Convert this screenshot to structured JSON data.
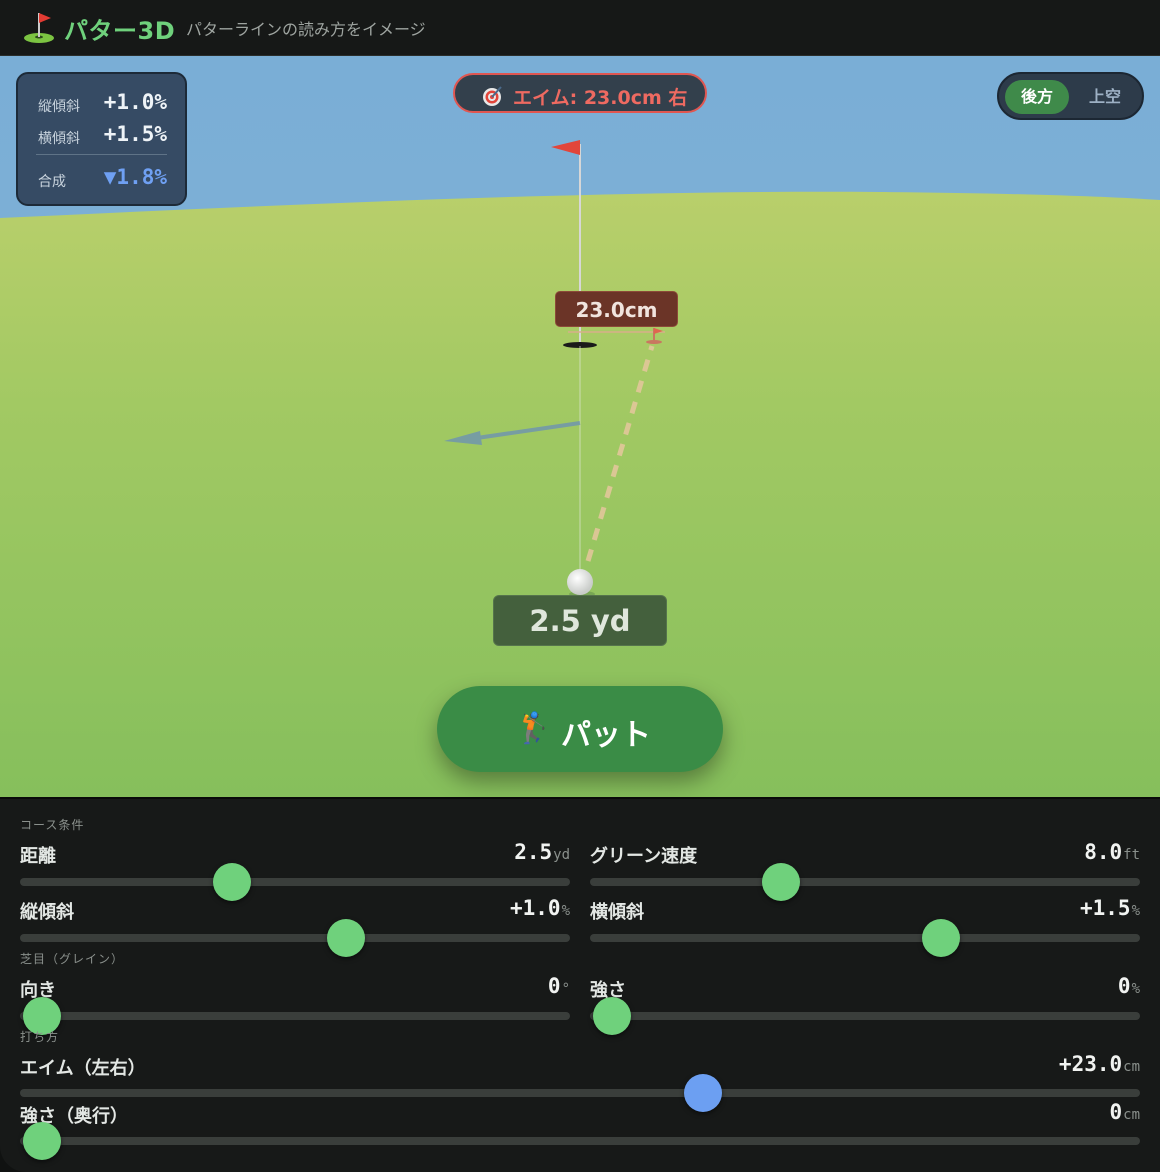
{
  "header": {
    "title": "パター3D",
    "subtitle": "パターラインの読み方をイメージ"
  },
  "scene": {
    "slope": {
      "vertical_label": "縦傾斜",
      "vertical_value": "+1.0%",
      "horizontal_label": "横傾斜",
      "horizontal_value": "+1.5%",
      "combined_label": "合成",
      "combined_value": "▼1.8%"
    },
    "aim_badge": "エイム: 23.0cm 右",
    "view_toggle": {
      "options": [
        "後方",
        "上空"
      ],
      "selected": "後方"
    },
    "aim_distance_label": "23.0cm",
    "ball_distance_label": "2.5 yd",
    "putt_button": {
      "label": "パット"
    }
  },
  "controls": {
    "sections": {
      "course": "コース条件",
      "grain": "芝目（グレイン）",
      "stroke": "打ち方"
    },
    "distance": {
      "label": "距離",
      "value": "2.5",
      "unit": "yd",
      "fraction": 0.385
    },
    "green_speed": {
      "label": "グリーン速度",
      "value": "8.0",
      "unit": "ft",
      "fraction": 0.347
    },
    "vertical": {
      "label": "縦傾斜",
      "value": "+1.0",
      "unit": "%",
      "fraction": 0.592
    },
    "horizontal": {
      "label": "横傾斜",
      "value": "+1.5",
      "unit": "%",
      "fraction": 0.638
    },
    "grain_dir": {
      "label": "向き",
      "value": "0",
      "unit": "°",
      "fraction": 0.0
    },
    "grain_str": {
      "label": "強さ",
      "value": "0",
      "unit": "%",
      "fraction": 0.0
    },
    "aim": {
      "label": "エイム（左右）",
      "value": "+23.0",
      "unit": "cm",
      "fraction": 0.61
    },
    "power": {
      "label": "強さ（奥行）",
      "value": "0",
      "unit": "cm",
      "fraction": 0.0
    }
  },
  "colors": {
    "accent_green": "#6fd17c",
    "aim_red": "#e05651",
    "aim_slider_blue": "#6c9ff2"
  }
}
